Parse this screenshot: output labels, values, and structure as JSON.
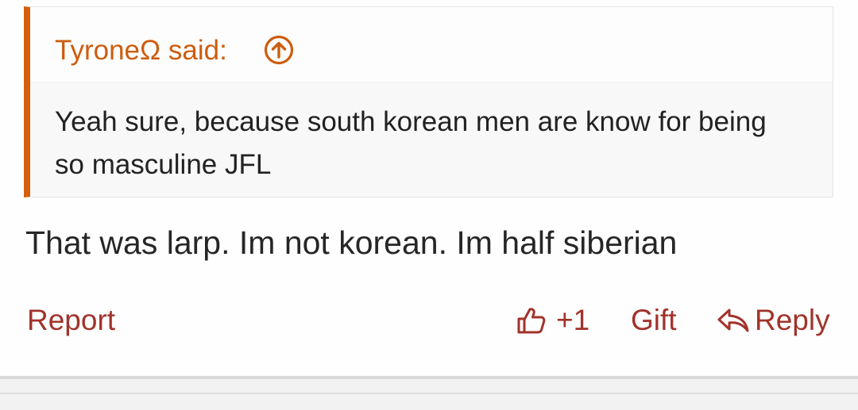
{
  "quote": {
    "author_said": "TyroneΩ said:",
    "body": "Yeah sure, because south korean men are know for being so masculine JFL",
    "accent_color": "#d35f0b",
    "jump_icon": "arrow-circle-up-icon"
  },
  "message": {
    "text": "That was larp. Im not korean. Im half siberian"
  },
  "actions": {
    "report_label": "Report",
    "like_icon": "thumbs-up-icon",
    "like_count": "+1",
    "gift_label": "Gift",
    "reply_icon": "reply-arrow-icon",
    "reply_label": "Reply",
    "color": "#a1332b"
  }
}
